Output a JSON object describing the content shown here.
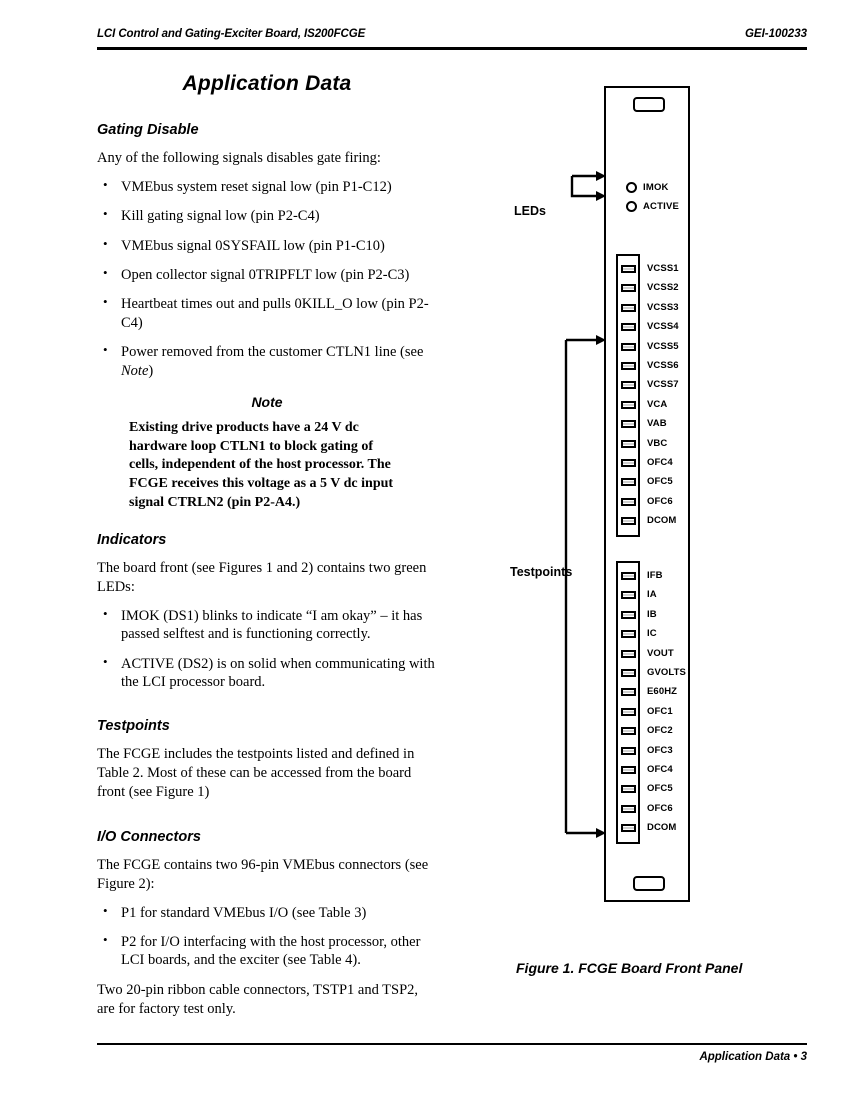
{
  "header": {
    "left": "LCI Control and Gating-Exciter Board, IS200FCGE",
    "right": "GEI-100233"
  },
  "footer": {
    "right": "Application Data • 3"
  },
  "chapter_title": "Application Data",
  "sections": {
    "gating_disable": {
      "heading": "Gating Disable",
      "intro": "Any of the following signals disables gate firing:",
      "bullets": [
        "VMEbus system reset signal low (pin P1-C12)",
        "Kill gating signal low (pin P2-C4)",
        "VMEbus signal 0SYSFAIL low (pin P1-C10)",
        "Open collector signal 0TRIPFLT low (pin P2-C3)",
        "Heartbeat times out and pulls 0KILL_O low (pin P2-C4)"
      ],
      "bullet_power_pre": "Power removed from the customer CTLN1 line (see ",
      "bullet_power_ital": "Note",
      "bullet_power_post": ")"
    },
    "note": {
      "title": "Note",
      "body": "Existing drive products have a 24 V dc hardware loop CTLN1 to block gating of cells, independent of the host processor. The FCGE receives this voltage as a 5 V dc input signal CTRLN2 (pin P2-A4.)"
    },
    "indicators": {
      "heading": "Indicators",
      "intro": "The board front (see Figures 1 and 2) contains two green LEDs:",
      "bullets": [
        "IMOK (DS1) blinks to indicate “I am okay” – it has passed selftest and is functioning correctly.",
        "ACTIVE (DS2) is on solid when communicating with the LCI processor board."
      ]
    },
    "testpoints": {
      "heading": "Testpoints",
      "body": "The FCGE includes the testpoints listed and defined in Table 2. Most of these can be accessed from the board front (see Figure 1)"
    },
    "io_connectors": {
      "heading": "I/O Connectors",
      "intro": "The FCGE contains two 96-pin VMEbus connectors (see Figure 2):",
      "bullets": [
        "P1 for standard VMEbus I/O (see Table 3)",
        "P2 for I/O interfacing with the host processor, other LCI boards, and the exciter (see Table 4)."
      ],
      "closing": "Two 20-pin ribbon cable connectors, TSTP1 and TSP2, are for factory test only."
    }
  },
  "figure": {
    "caption": "Figure 1.  FCGE Board Front Panel",
    "callouts": {
      "leds": "LEDs",
      "testpoints": "Testpoints"
    },
    "leds": [
      {
        "label": "IMOK"
      },
      {
        "label": "ACTIVE"
      }
    ],
    "testpoint_group_top": [
      "VCSS1",
      "VCSS2",
      "VCSS3",
      "VCSS4",
      "VCSS5",
      "VCSS6",
      "VCSS7",
      "VCA",
      "VAB",
      "VBC",
      "OFC4",
      "OFC5",
      "OFC6",
      "DCOM"
    ],
    "testpoint_group_bottom": [
      "IFB",
      "IA",
      "IB",
      "IC",
      "VOUT",
      "GVOLTS",
      "E60HZ",
      "OFC1",
      "OFC2",
      "OFC3",
      "OFC4",
      "OFC5",
      "OFC6",
      "DCOM"
    ]
  },
  "colors": {
    "ink": "#000000",
    "paper": "#ffffff",
    "jack_fill": "#d0d0d0"
  }
}
